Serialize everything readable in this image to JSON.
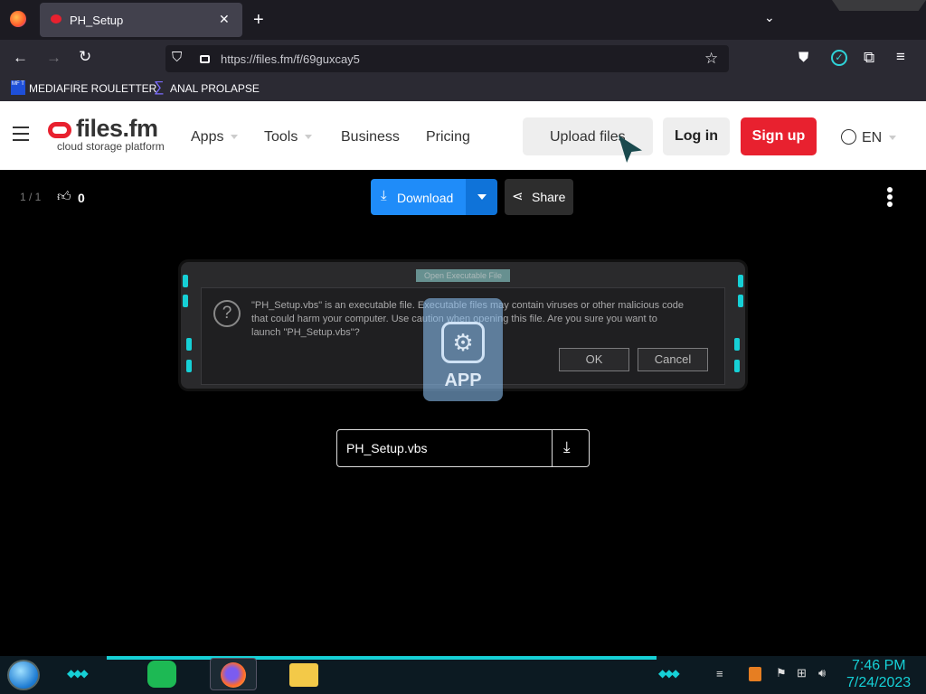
{
  "browser": {
    "tab_title": "PH_Setup",
    "url": "https://files.fm/f/69guxcay5",
    "bookmarks": [
      {
        "icon": "mediafire-icon",
        "label": "MEDIAFIRE ROULETTER"
      },
      {
        "icon": "sigma-icon",
        "label": "ANAL PROLAPSE"
      }
    ]
  },
  "site": {
    "logo_text": "files.fm",
    "logo_tagline": "cloud storage platform",
    "nav": [
      "Apps",
      "Tools",
      "Business",
      "Pricing"
    ],
    "upload_label": "Upload files",
    "login_label": "Log in",
    "signup_label": "Sign up",
    "language": "EN"
  },
  "viewer": {
    "page_counter": "1 / 1",
    "likes": "0",
    "download_label": "Download",
    "share_label": "Share",
    "filename": "PH_Setup.vbs",
    "file_type_label": "APP"
  },
  "dialog": {
    "title": "Open Executable File",
    "message_line1": "\"PH_Setup.vbs\" is an executable file. Executable files may contain viruses or other malicious code",
    "message_line2": "that could harm your computer. Use caution when opening this file. Are you sure you want to",
    "message_line3": "launch \"PH_Setup.vbs\"?",
    "ok_label": "OK",
    "cancel_label": "Cancel"
  },
  "taskbar": {
    "time": "7:46 PM",
    "date": "7/24/2023"
  },
  "colors": {
    "brand_red": "#e8212f",
    "download_blue": "#1f8cf9",
    "taskbar_accent": "#16d0d6"
  }
}
